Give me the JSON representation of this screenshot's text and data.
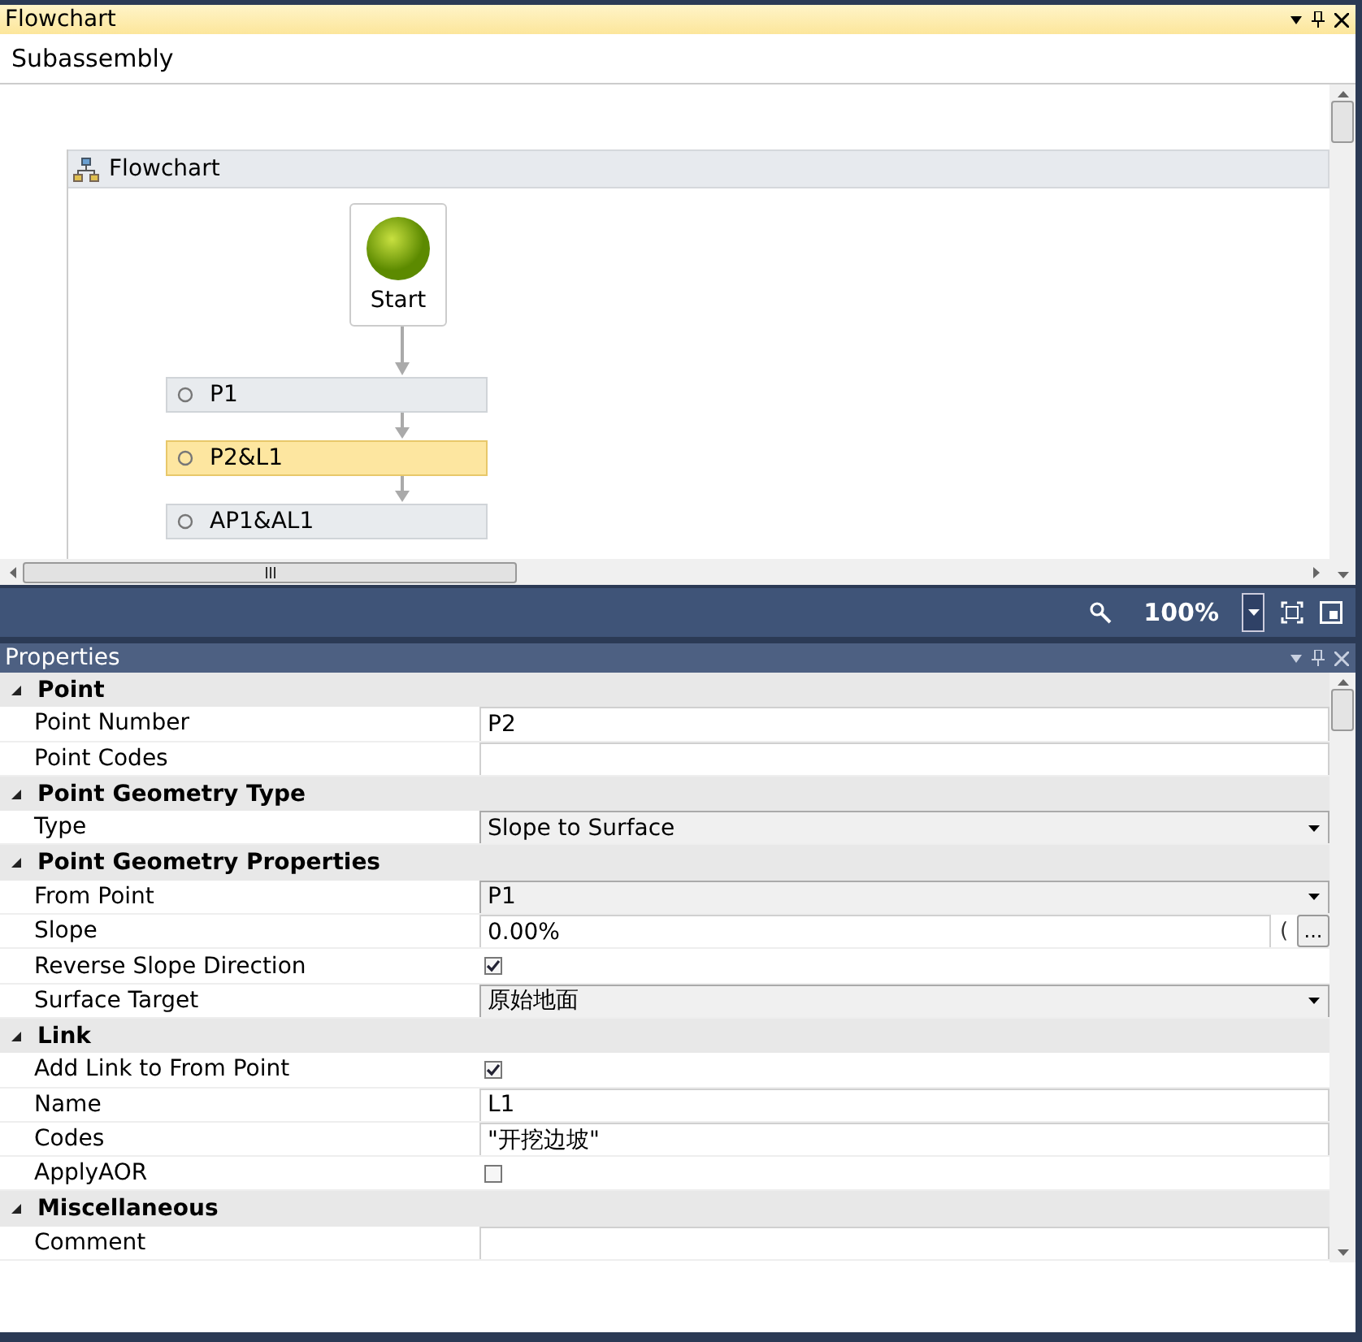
{
  "flowchart_pane": {
    "title": "Flowchart",
    "breadcrumb": "Subassembly",
    "designer": {
      "title": "Flowchart",
      "start": {
        "label": "Start"
      },
      "activities": [
        {
          "label": "P1",
          "selected": false
        },
        {
          "label": "P2&L1",
          "selected": true
        },
        {
          "label": "AP1&AL1",
          "selected": false
        }
      ]
    },
    "zoom": {
      "value": "100%"
    }
  },
  "properties_pane": {
    "title": "Properties",
    "sections": [
      {
        "title": "Point",
        "expanded": true,
        "rows": [
          {
            "label": "Point Number",
            "kind": "text",
            "value": "P2"
          },
          {
            "label": "Point Codes",
            "kind": "text"
          }
        ]
      },
      {
        "title": "Point Geometry Type",
        "expanded": true,
        "rows": [
          {
            "label": "Type",
            "kind": "dropdown",
            "value": "Slope to Surface"
          }
        ]
      },
      {
        "title": "Point Geometry Properties",
        "expanded": true,
        "rows": [
          {
            "label": "From Point",
            "kind": "dropdown",
            "value": "P1"
          },
          {
            "label": "Slope",
            "kind": "text-button",
            "value": "0.00%",
            "suffix": "(",
            "button": "..."
          },
          {
            "label": "Reverse Slope Direction",
            "kind": "check",
            "checked": true
          },
          {
            "label": "Surface Target",
            "kind": "dropdown",
            "value": "原始地面"
          }
        ]
      },
      {
        "title": "Link",
        "expanded": true,
        "rows": [
          {
            "label": "Add Link to From Point",
            "kind": "check",
            "checked": true
          },
          {
            "label": "Name",
            "kind": "text",
            "value": "L1"
          },
          {
            "label": "Codes",
            "kind": "text",
            "value": "\"开挖边坡\""
          },
          {
            "label": "ApplyAOR",
            "kind": "check",
            "checked": false
          }
        ]
      },
      {
        "title": "Miscellaneous",
        "expanded": true,
        "rows": [
          {
            "label": "Comment",
            "kind": "text"
          }
        ]
      }
    ]
  }
}
